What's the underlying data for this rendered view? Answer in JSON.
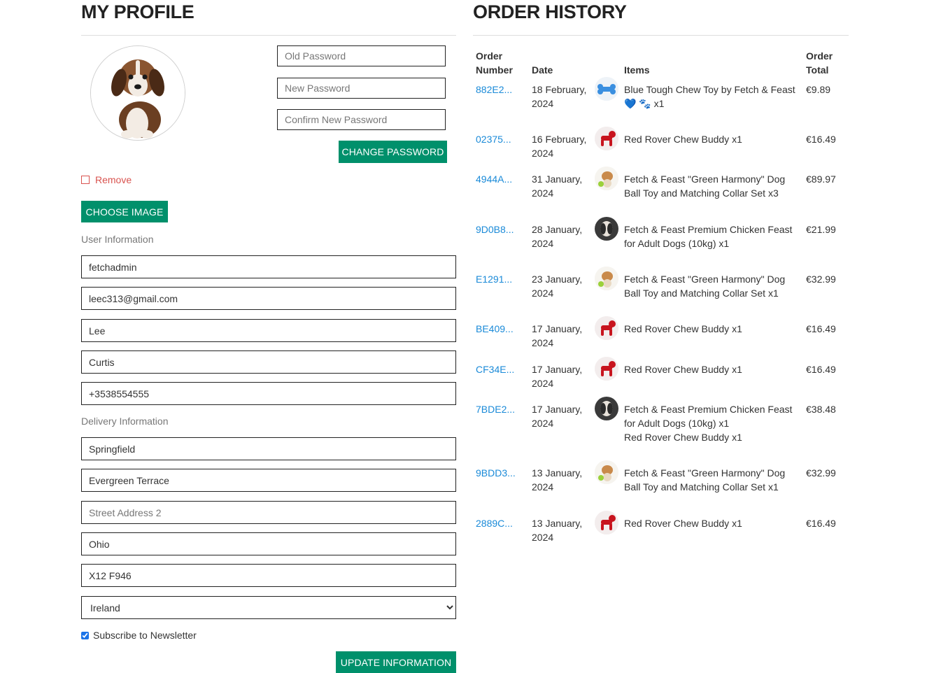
{
  "profile": {
    "title": "MY PROFILE",
    "avatar_icon": "puppy-photo",
    "password": {
      "old_placeholder": "Old Password",
      "new_placeholder": "New Password",
      "confirm_placeholder": "Confirm New Password",
      "change_button": "CHANGE PASSWORD"
    },
    "remove_label": "Remove",
    "choose_image_button": "CHOOSE IMAGE",
    "user_info_heading": "User Information",
    "user_info": {
      "username": "fetchadmin",
      "email": "leec313@gmail.com",
      "first_name": "Lee",
      "last_name": "Curtis",
      "phone": "+3538554555"
    },
    "delivery_heading": "Delivery Information",
    "delivery": {
      "town": "Springfield",
      "street1": "Evergreen Terrace",
      "street2_placeholder": "Street Address 2",
      "county": "Ohio",
      "postcode": "X12 F946",
      "country": "Ireland"
    },
    "newsletter_label": "Subscribe to Newsletter",
    "newsletter_checked": true,
    "update_button": "UPDATE INFORMATION",
    "accent_color": "#00906b"
  },
  "orders": {
    "title": "ORDER HISTORY",
    "headers": {
      "order_number_1": "Order",
      "order_number_2": "Number",
      "date": "Date",
      "items": "Items",
      "total_1": "Order",
      "total_2": "Total"
    },
    "rows": [
      {
        "id": "882E2...",
        "date": "18 February, 2024",
        "thumb": "blue-bone-toy",
        "items": [
          "Blue Tough Chew Toy by Fetch & Feast 💙 🐾 x1"
        ],
        "total": "€9.89"
      },
      {
        "id": "02375...",
        "date": "16 February, 2024",
        "thumb": "red-dog-toy",
        "items": [
          "Red Rover Chew Buddy x1"
        ],
        "total": "€16.49"
      },
      {
        "id": "4944A...",
        "date": "31 January, 2024",
        "thumb": "dog-ball-collar",
        "items": [
          "Fetch & Feast \"Green Harmony\" Dog Ball Toy and Matching Collar Set x3"
        ],
        "total": "€89.97"
      },
      {
        "id": "9D0B8...",
        "date": "28 January, 2024",
        "thumb": "dog-food-bag",
        "items": [
          "Fetch & Feast Premium Chicken Feast for Adult Dogs (10kg) x1"
        ],
        "total": "€21.99"
      },
      {
        "id": "E1291...",
        "date": "23 January, 2024",
        "thumb": "dog-ball-collar",
        "items": [
          "Fetch & Feast \"Green Harmony\" Dog Ball Toy and Matching Collar Set x1"
        ],
        "total": "€32.99"
      },
      {
        "id": "BE409...",
        "date": "17 January, 2024",
        "thumb": "red-dog-toy",
        "items": [
          "Red Rover Chew Buddy x1"
        ],
        "total": "€16.49"
      },
      {
        "id": "CF34E...",
        "date": "17 January, 2024",
        "thumb": "red-dog-toy",
        "items": [
          "Red Rover Chew Buddy x1"
        ],
        "total": "€16.49"
      },
      {
        "id": "7BDE2...",
        "date": "17 January, 2024",
        "thumb": "dog-food-bag",
        "items": [
          "Fetch & Feast Premium Chicken Feast for Adult Dogs (10kg) x1",
          "Red Rover Chew Buddy x1"
        ],
        "total": "€38.48"
      },
      {
        "id": "9BDD3...",
        "date": "13 January, 2024",
        "thumb": "dog-ball-collar",
        "items": [
          "Fetch & Feast \"Green Harmony\" Dog Ball Toy and Matching Collar Set x1"
        ],
        "total": "€32.99"
      },
      {
        "id": "2889C...",
        "date": "13 January, 2024",
        "thumb": "red-dog-toy",
        "items": [
          "Red Rover Chew Buddy x1"
        ],
        "total": "€16.49"
      }
    ],
    "link_color": "#1a8ad8"
  }
}
